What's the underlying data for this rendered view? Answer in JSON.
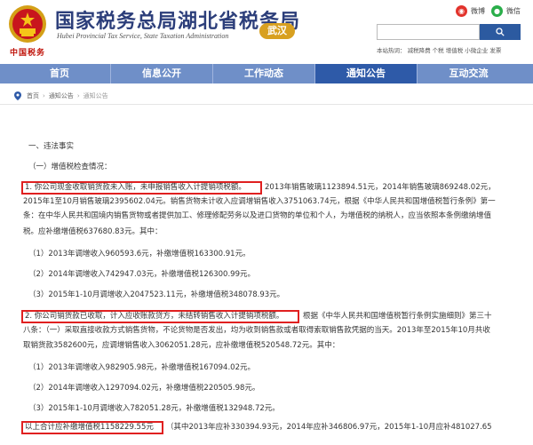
{
  "header": {
    "title_cn": "国家税务总局湖北省税务局",
    "title_en": "Hubei Provincial Tax Service, State Taxation Administration",
    "site_mark": "中国税务",
    "city_badge": "武汉",
    "social": {
      "weibo": "微博",
      "wechat": "微信"
    },
    "search": {
      "value": "",
      "hints": "本站热词： 减税降费 个税 增值税 小微企业 发票"
    }
  },
  "nav": {
    "items": [
      {
        "label": "首页"
      },
      {
        "label": "信息公开"
      },
      {
        "label": "工作动态"
      },
      {
        "label": "通知公告"
      },
      {
        "label": "互动交流"
      }
    ],
    "active_index": 3
  },
  "breadcrumb": {
    "home": "首页",
    "section": "通知公告",
    "current": "通知公告"
  },
  "content": {
    "heading": "一、违法事实",
    "sub_heading": "（一）增值税检查情况：",
    "p1": {
      "highlight": "1. 你公司现金收取销货款未入账，未申报销售收入计提销项税额。",
      "line1_rest": "2013年销售玻璃1123894.51元，2014年销售玻璃869248.02元，",
      "line2": "2015年1至10月销售玻璃2395602.04元。销售货物未计收入应调增销售收入3751063.74元，根据《中华人民共和国增值税暂行条例》第一",
      "line3": "条：在中华人民共和国境内销售货物或者提供加工、修理修配劳务以及进口货物的单位和个人，为增值税的纳税人，应当依照本条例缴纳增值",
      "line4": "税。应补缴增值税637680.83元。其中："
    },
    "p1_items": [
      "（1）2013年调增收入960593.6元，补缴增值税163300.91元。",
      "（2）2014年调增收入742947.03元，补缴增值税126300.99元。",
      "（3）2015年1-10月调增收入2047523.11元，补缴增值税348078.93元。"
    ],
    "p2": {
      "highlight": "2. 你公司销货款已收取，计入应收账款贷方，未结转销售收入计提销项税额。",
      "line1_rest": "根据《中华人民共和国增值税暂行条例实施细则》第三十",
      "line2": "八条：（一）采取直接收款方式销售货物，不论货物是否发出，均为收到销售款或者取得索取销售款凭据的当天。2013年至2015年10月共收",
      "line3": "取销货款3582600元，应调增销售收入3062051.28元，应补缴增值税520548.72元。其中："
    },
    "p2_items": [
      "（1）2013年调增收入982905.98元，补缴增值税167094.02元。",
      "（2）2014年调增收入1297094.02元，补缴增值税220505.98元。",
      "（3）2015年1-10月调增收入782051.28元，补缴增值税132948.72元。"
    ],
    "total": {
      "highlight": "以上合计应补缴增值税1158229.55元",
      "rest": "（其中2013年应补330394.93元，2014年应补346806.97元，2015年1-10月应补481027.65"
    }
  },
  "colors": {
    "nav_bg": "#6f8fc8",
    "nav_active": "#2e5aa8",
    "title": "#2c3e7a",
    "badge": "#d8a020",
    "highlight_border": "#e02020"
  }
}
